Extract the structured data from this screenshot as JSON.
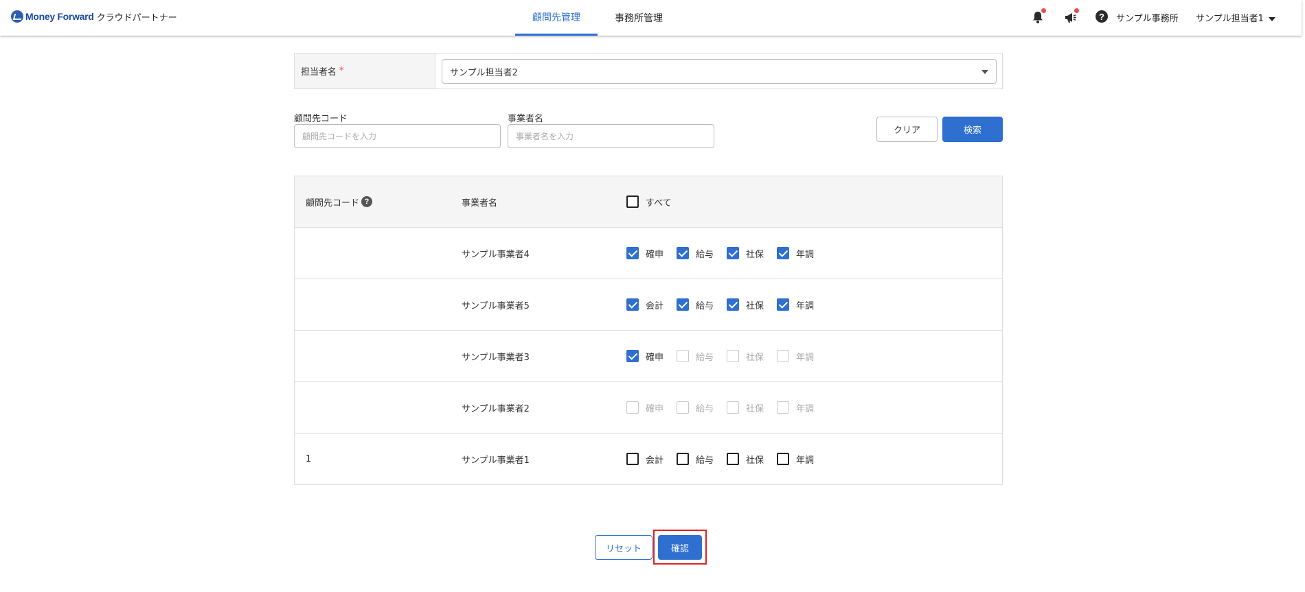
{
  "header": {
    "logo_brand": "Money Forward",
    "logo_product": "クラウドパートナー",
    "tabs": [
      {
        "label": "顧問先管理",
        "active": true
      },
      {
        "label": "事務所管理",
        "active": false
      }
    ],
    "office_name": "サンプル事務所",
    "user_name": "サンプル担当者1",
    "icons": [
      "bell-icon",
      "megaphone-icon",
      "help-icon"
    ]
  },
  "assignee": {
    "label": "担当者名",
    "required_mark": "*",
    "selected": "サンプル担当者2"
  },
  "search": {
    "client_code_label": "顧問先コード",
    "client_code_placeholder": "顧問先コードを入力",
    "business_name_label": "事業者名",
    "business_name_placeholder": "事業者名を入力",
    "clear_label": "クリア",
    "search_label": "検索"
  },
  "table": {
    "headers": {
      "client_code": "顧問先コード",
      "business_name": "事業者名",
      "select_all": "すべて"
    },
    "select_all_checked": false,
    "rows": [
      {
        "code": "",
        "name": "サンプル事業者4",
        "options": [
          {
            "label": "確申",
            "checked": true,
            "disabled": false
          },
          {
            "label": "給与",
            "checked": true,
            "disabled": false
          },
          {
            "label": "社保",
            "checked": true,
            "disabled": false
          },
          {
            "label": "年調",
            "checked": true,
            "disabled": false
          }
        ]
      },
      {
        "code": "",
        "name": "サンプル事業者5",
        "options": [
          {
            "label": "会計",
            "checked": true,
            "disabled": false
          },
          {
            "label": "給与",
            "checked": true,
            "disabled": false
          },
          {
            "label": "社保",
            "checked": true,
            "disabled": false
          },
          {
            "label": "年調",
            "checked": true,
            "disabled": false
          }
        ]
      },
      {
        "code": "",
        "name": "サンプル事業者3",
        "options": [
          {
            "label": "確申",
            "checked": true,
            "disabled": false
          },
          {
            "label": "給与",
            "checked": false,
            "disabled": true
          },
          {
            "label": "社保",
            "checked": false,
            "disabled": true
          },
          {
            "label": "年調",
            "checked": false,
            "disabled": true
          }
        ]
      },
      {
        "code": "",
        "name": "サンプル事業者2",
        "options": [
          {
            "label": "確申",
            "checked": false,
            "disabled": true
          },
          {
            "label": "給与",
            "checked": false,
            "disabled": true
          },
          {
            "label": "社保",
            "checked": false,
            "disabled": true
          },
          {
            "label": "年調",
            "checked": false,
            "disabled": true
          }
        ]
      },
      {
        "code": "1",
        "name": "サンプル事業者1",
        "options": [
          {
            "label": "会計",
            "checked": false,
            "disabled": false
          },
          {
            "label": "給与",
            "checked": false,
            "disabled": false
          },
          {
            "label": "社保",
            "checked": false,
            "disabled": false
          },
          {
            "label": "年調",
            "checked": false,
            "disabled": false
          }
        ]
      }
    ]
  },
  "footer": {
    "reset_label": "リセット",
    "confirm_label": "確認"
  },
  "colors": {
    "primary": "#2e6fd0",
    "highlight": "#e02020",
    "notification_dot": "#e84d4d"
  }
}
